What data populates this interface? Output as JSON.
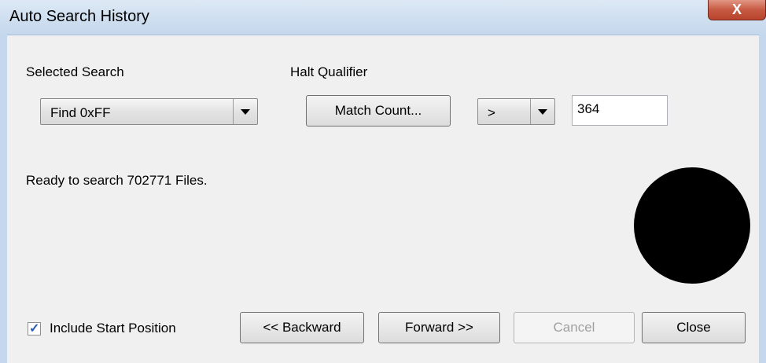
{
  "window": {
    "title": "Auto Search History",
    "close_glyph": "X"
  },
  "selected_search": {
    "label": "Selected Search",
    "value": "Find 0xFF"
  },
  "halt_qualifier": {
    "label": "Halt Qualifier",
    "match_button": "Match Count...",
    "operator": ">",
    "count": "364"
  },
  "status": {
    "text": "Ready to search 702771 Files."
  },
  "indicator": {
    "color": "#000000",
    "icon": "status-circle"
  },
  "include_start": {
    "label": "Include Start Position",
    "checked": true
  },
  "buttons": {
    "backward": "<< Backward",
    "forward": "Forward >>",
    "cancel": "Cancel",
    "close": "Close"
  }
}
